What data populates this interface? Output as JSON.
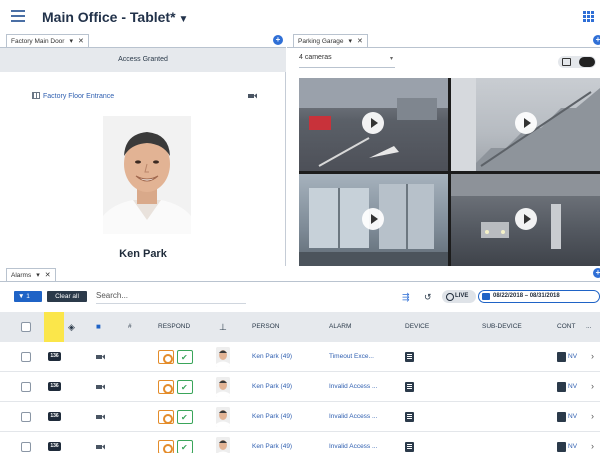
{
  "header": {
    "title": "Main Office - Tablet*"
  },
  "door_panel": {
    "tab_label": "Factory Main Door",
    "status": "Access Granted",
    "entrance": "Factory Floor Entrance",
    "person_name": "Ken Park"
  },
  "parking_panel": {
    "tab_label": "Parking Garage",
    "camera_count": "4 cameras"
  },
  "alarms": {
    "tab_label": "Alarms",
    "filter_count": "1",
    "clear_all": "Clear all",
    "search_placeholder": "Search...",
    "live": "LIVE",
    "date_range": "08/22/2018 – 08/31/2018",
    "columns": [
      "RESPOND",
      "PERSON",
      "ALARM",
      "DEVICE",
      "SUB-DEVICE",
      "CONT",
      "..."
    ],
    "rows": [
      {
        "priority": "136",
        "person": "Ken Park (49)",
        "alarm": "Timeout Exce...",
        "context": "NV"
      },
      {
        "priority": "136",
        "person": "Ken Park (49)",
        "alarm": "Invalid Access ...",
        "context": "NV"
      },
      {
        "priority": "136",
        "person": "Ken Park (49)",
        "alarm": "Invalid Access ...",
        "context": "NV"
      },
      {
        "priority": "136",
        "person": "Ken Park (49)",
        "alarm": "Invalid Access ...",
        "context": "NV"
      }
    ]
  },
  "colors": {
    "accent": "#1f63c6",
    "priority": "#fbe64a",
    "header_bg": "#e6e9ed"
  },
  "icons": [
    "hamburger-icon",
    "grid-icon",
    "close-icon",
    "add-icon",
    "door-icon",
    "camera-icon",
    "play-icon",
    "filter-icon",
    "history-icon",
    "calendar-icon",
    "checkbox-icon",
    "respond-icon",
    "acknowledge-icon",
    "device-icon",
    "chevron-right-icon"
  ]
}
